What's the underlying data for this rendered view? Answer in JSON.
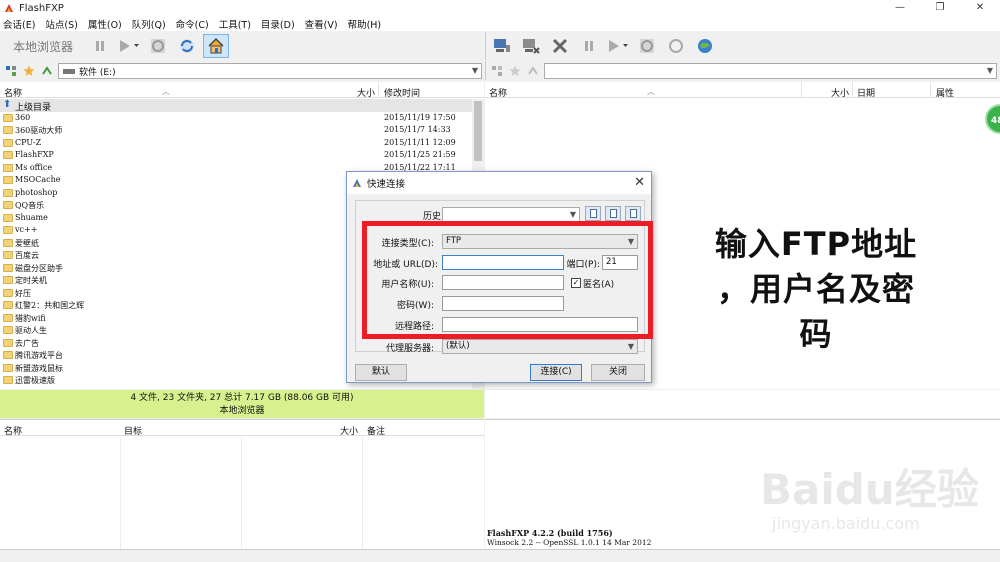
{
  "window": {
    "title": "FlashFXP",
    "controls": [
      "—",
      "❐",
      "✕"
    ]
  },
  "menu": [
    "会话(E)",
    "站点(S)",
    "属性(O)",
    "队列(Q)",
    "命令(C)",
    "工具(T)",
    "目录(D)",
    "查看(V)",
    "帮助(H)"
  ],
  "left_toolbar": {
    "label": "本地浏览器"
  },
  "left_address": {
    "value": "软件  (E:)"
  },
  "right_address": {
    "value": ""
  },
  "left_columns": {
    "name": "名称",
    "size": "大小",
    "modified": "修改时间"
  },
  "right_columns": {
    "name": "名称",
    "size": "大小",
    "date": "日期",
    "attr": "属性"
  },
  "files": [
    {
      "name": "上级目录",
      "time": ""
    },
    {
      "name": "360",
      "time": "2015/11/19 17:50"
    },
    {
      "name": "360驱动大师",
      "time": "2015/11/7 14:33"
    },
    {
      "name": "CPU-Z",
      "time": "2015/11/11 12:09"
    },
    {
      "name": "FlashFXP",
      "time": "2015/11/25 21:59"
    },
    {
      "name": "Ms office",
      "time": "2015/11/22 17:11"
    },
    {
      "name": "MSOCache",
      "time": ""
    },
    {
      "name": "photoshop",
      "time": ""
    },
    {
      "name": "QQ音乐",
      "time": ""
    },
    {
      "name": "Shuame",
      "time": ""
    },
    {
      "name": "vc++",
      "time": ""
    },
    {
      "name": "爱壁纸",
      "time": ""
    },
    {
      "name": "百度云",
      "time": ""
    },
    {
      "name": "磁盘分区助手",
      "time": ""
    },
    {
      "name": "定时关机",
      "time": ""
    },
    {
      "name": "好压",
      "time": ""
    },
    {
      "name": "红警2：共和国之辉",
      "time": ""
    },
    {
      "name": "猎豹wifi",
      "time": ""
    },
    {
      "name": "驱动人生",
      "time": ""
    },
    {
      "name": "去广告",
      "time": ""
    },
    {
      "name": "腾讯游戏平台",
      "time": ""
    },
    {
      "name": "新盟游戏鼠标",
      "time": ""
    },
    {
      "name": "迅雷极速版",
      "time": ""
    }
  ],
  "status": {
    "line1": "4 文件, 23 文件夹, 27 总计 7.17 GB (88.06 GB 可用)",
    "line2": "本地浏览器"
  },
  "queue_columns": {
    "name": "名称",
    "target": "目标",
    "size": "大小",
    "note": "备注"
  },
  "log": {
    "line1": "FlashFXP 4.2.2 (build 1756)",
    "line2": "Winsock 2.2 -- OpenSSL 1.0.1 14 Mar 2012"
  },
  "badge": "48",
  "dialog": {
    "title": "快速连接",
    "history_label": "历史:",
    "conn_type_label": "连接类型(C):",
    "conn_type_value": "FTP",
    "address_label": "地址或 URL(D):",
    "address_value": "",
    "port_label": "端口(P):",
    "port_value": "21",
    "user_label": "用户名称(U):",
    "user_value": "",
    "anon_label": "匿名(A)",
    "anon_checked": true,
    "password_label": "密码(W):",
    "remote_path_label": "远程路径:",
    "proxy_label": "代理服务器:",
    "proxy_value": "(默认)",
    "btn_default": "默认",
    "btn_connect": "连接(C)",
    "btn_close": "关闭"
  },
  "annotation": [
    "输入FTP地址",
    "，用户名及密",
    "码"
  ],
  "watermark": {
    "main": "Baidu经验",
    "sub": "jingyan.baidu.com"
  },
  "colors": {
    "status_green": "#d9f08e",
    "highlight_red": "#ee1c25",
    "badge_green": "#3bb34a"
  }
}
